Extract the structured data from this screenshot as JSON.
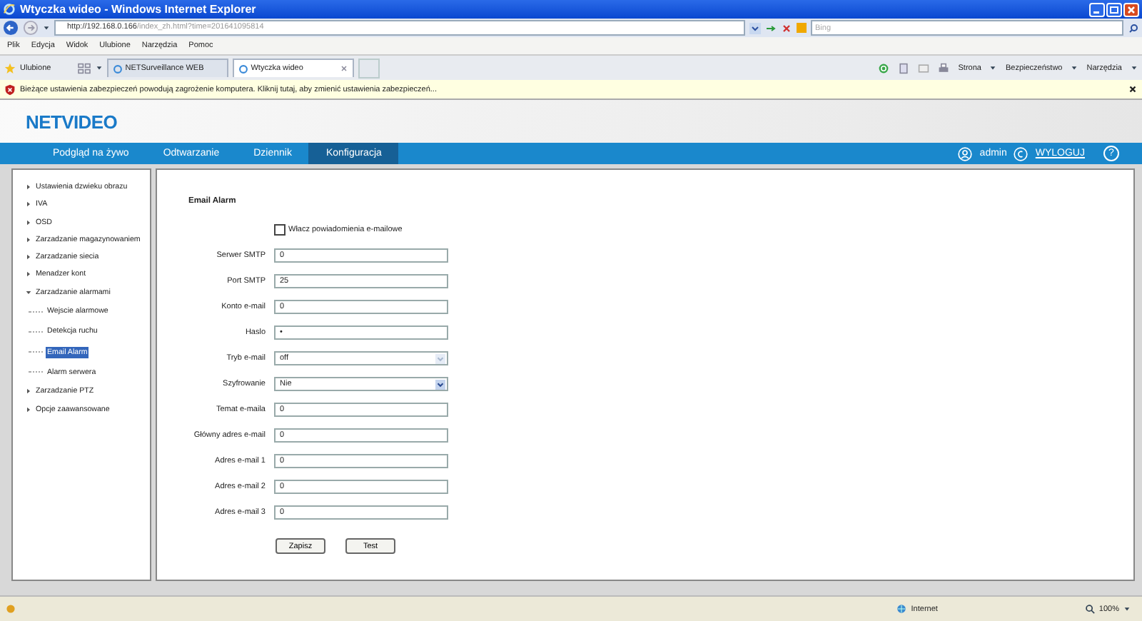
{
  "window": {
    "title": "Wtyczka wideo - Windows Internet Explorer"
  },
  "address_bar": {
    "url_host": "http://192.168.0.166",
    "url_rest": "/index_zh.html?time=201641095814",
    "search_placeholder": "Bing"
  },
  "menu": [
    "Plik",
    "Edycja",
    "Widok",
    "Ulubione",
    "Narzędzia",
    "Pomoc"
  ],
  "favorites": {
    "label": "Ulubione"
  },
  "tabs": [
    {
      "label": "NETSurveillance WEB",
      "selected": false
    },
    {
      "label": "Wtyczka wideo",
      "selected": true
    }
  ],
  "commands": [
    "Strona",
    "Bezpieczeństwo",
    "Narzędzia"
  ],
  "infobar": {
    "text": "Bieżące ustawienia zabezpieczeń powodują zagrożenie komputera. Kliknij tutaj, aby zmienić ustawienia zabezpieczeń..."
  },
  "app": {
    "logo": "NETVIDEO",
    "nav": [
      {
        "label": "Podgląd na żywo",
        "selected": false
      },
      {
        "label": "Odtwarzanie",
        "selected": false
      },
      {
        "label": "Dziennik",
        "selected": false
      },
      {
        "label": "Konfiguracja",
        "selected": true
      }
    ],
    "user": "admin",
    "logout": "WYLOGUJ",
    "help": "?"
  },
  "sidebar": {
    "items": [
      {
        "label": "Ustawienia dzwieku obrazu",
        "expanded": false
      },
      {
        "label": "IVA",
        "expanded": false
      },
      {
        "label": "OSD",
        "expanded": false
      },
      {
        "label": "Zarzadzanie magazynowaniem",
        "expanded": false
      },
      {
        "label": "Zarzadzanie siecia",
        "expanded": false
      },
      {
        "label": "Menadzer kont",
        "expanded": false
      },
      {
        "label": "Zarzadzanie alarmami",
        "expanded": true,
        "children": [
          {
            "label": "Wejscie alarmowe",
            "selected": false
          },
          {
            "label": "Detekcja ruchu",
            "selected": false
          },
          {
            "label": "Email Alarm",
            "selected": true
          },
          {
            "label": "Alarm serwera",
            "selected": false
          }
        ]
      },
      {
        "label": "Zarzadzanie PTZ",
        "expanded": false
      },
      {
        "label": "Opcje zaawansowane",
        "expanded": false
      }
    ]
  },
  "form": {
    "title": "Email Alarm",
    "enable": {
      "label": "Włacz powiadomienia e-mailowe",
      "checked": false
    },
    "fields": [
      {
        "label": "Serwer SMTP",
        "kind": "text",
        "value": "0"
      },
      {
        "label": "Port SMTP",
        "kind": "text",
        "value": "25"
      },
      {
        "label": "Konto e-mail",
        "kind": "text",
        "value": "0"
      },
      {
        "label": "Haslo",
        "kind": "password",
        "value": "•"
      },
      {
        "label": "Tryb e-mail",
        "kind": "select",
        "value": "off",
        "disabled": true
      },
      {
        "label": "Szyfrowanie",
        "kind": "select",
        "value": "Nie",
        "disabled": false
      },
      {
        "label": "Temat e-maila",
        "kind": "text",
        "value": "0"
      },
      {
        "label": "Główny adres e-mail",
        "kind": "text",
        "value": "0"
      },
      {
        "label": "Adres e-mail 1",
        "kind": "text",
        "value": "0"
      },
      {
        "label": "Adres e-mail 2",
        "kind": "text",
        "value": "0"
      },
      {
        "label": "Adres e-mail 3",
        "kind": "text",
        "value": "0"
      }
    ],
    "buttons": [
      "Zapisz",
      "Test"
    ]
  },
  "status_bar": {
    "zone": "Internet",
    "zoom": "100%"
  }
}
